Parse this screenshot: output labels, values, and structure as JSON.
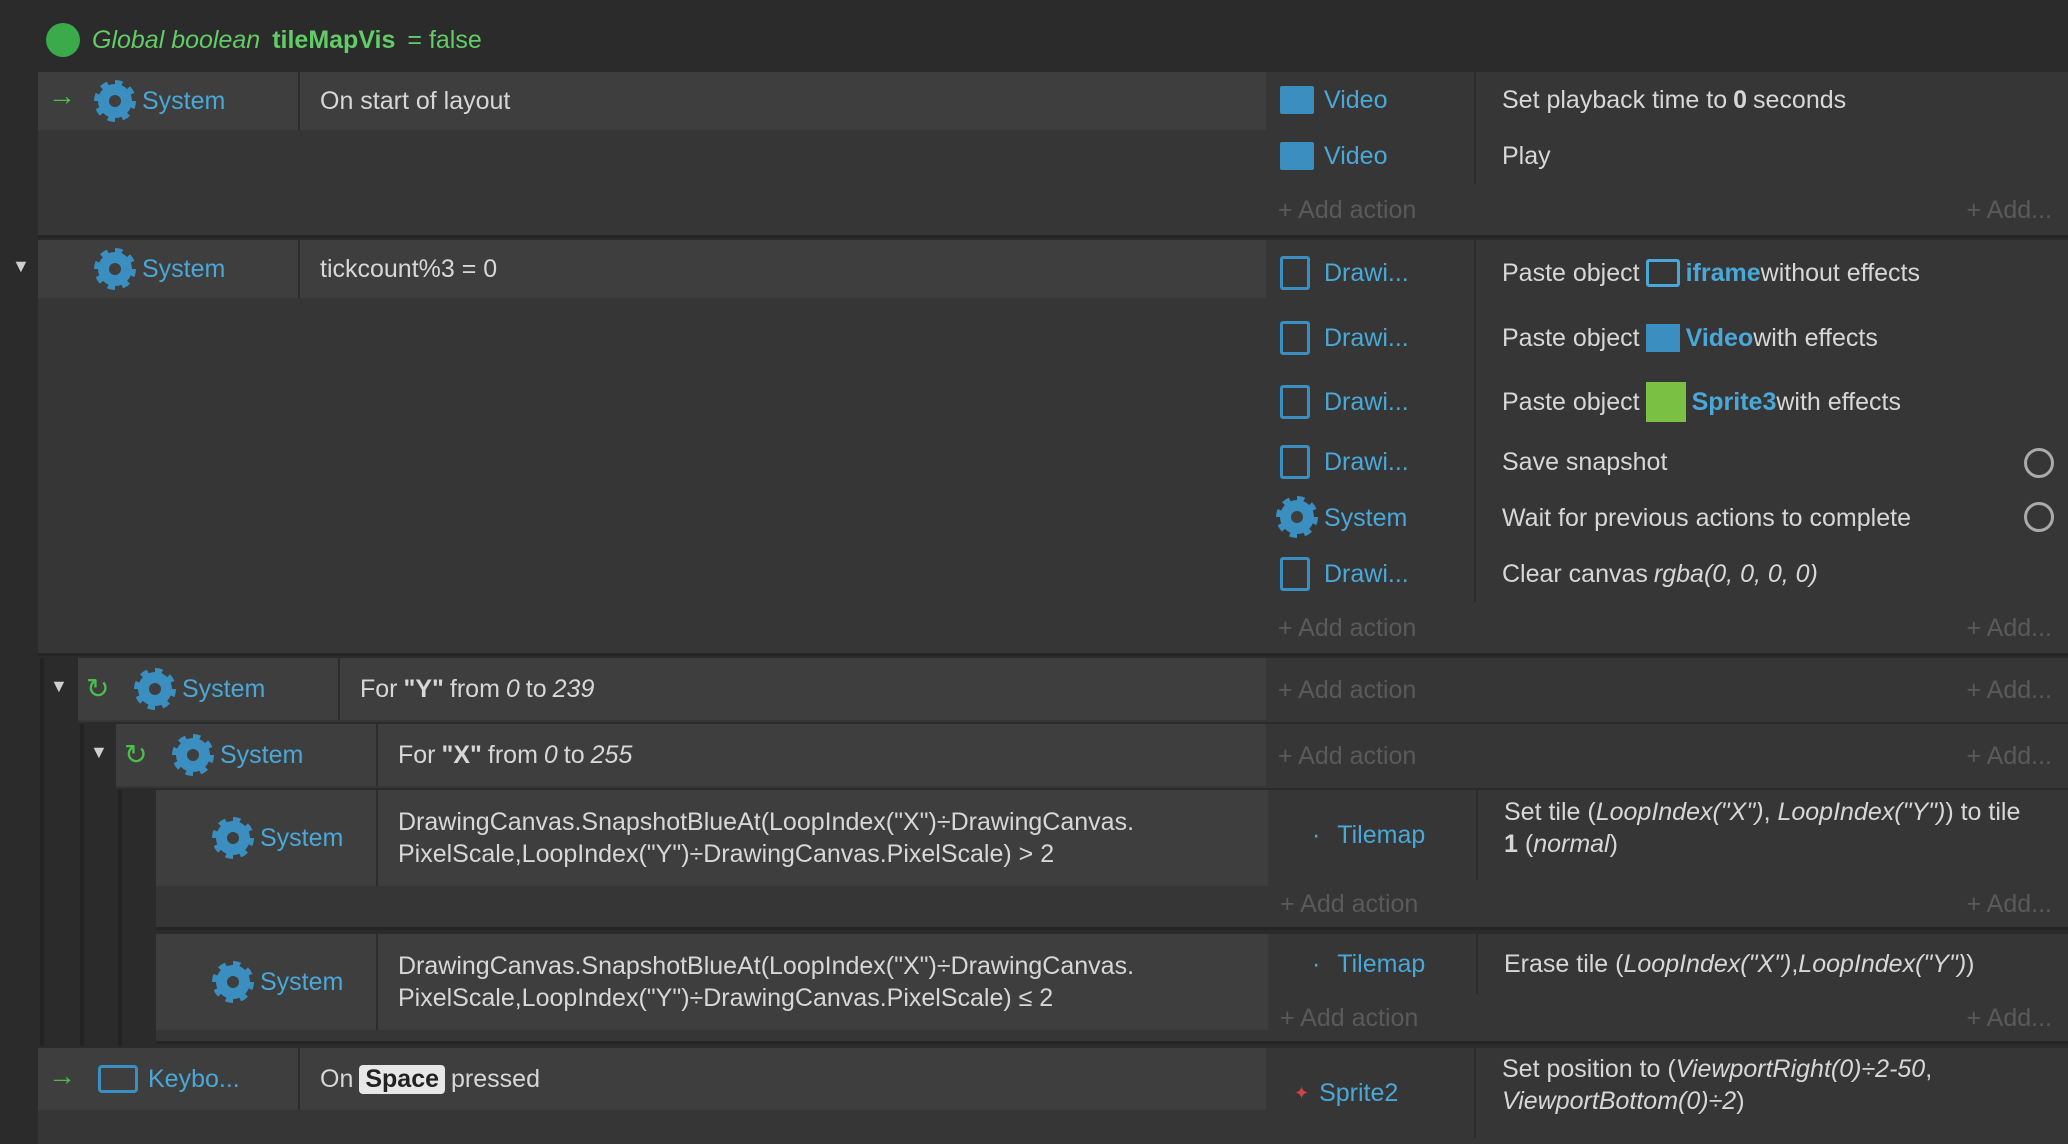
{
  "global": {
    "kw": "Global boolean",
    "name": "tileMapVis",
    "val": "= false"
  },
  "ev1": {
    "obj": "System",
    "cond": "On start of layout",
    "actions": [
      {
        "obj": "Video",
        "pre": "Set playback time to ",
        "bold": "0",
        "post": " seconds"
      },
      {
        "obj": "Video",
        "text": "Play"
      }
    ]
  },
  "ev2": {
    "obj": "System",
    "cond": "tickcount%3 = 0",
    "actions": [
      {
        "obj": "Drawi...",
        "pre": "Paste object ",
        "hl": "iframe",
        "post": " without effects"
      },
      {
        "obj": "Drawi...",
        "pre": "Paste object ",
        "hl": "Video",
        "post": " with effects"
      },
      {
        "obj": "Drawi...",
        "pre": "Paste object ",
        "hl": "Sprite3",
        "post": " with effects"
      },
      {
        "obj": "Drawi...",
        "text": "Save snapshot"
      },
      {
        "obj": "System",
        "text": "Wait for previous actions to complete"
      },
      {
        "obj": "Drawi...",
        "pre": "Clear canvas ",
        "it": "rgba(0, 0, 0, 0)"
      }
    ]
  },
  "ev3": {
    "obj": "System",
    "pre": "For ",
    "b": "\"Y\"",
    "mid": " from ",
    "a": "0",
    "to": " to ",
    "z": "239"
  },
  "ev4": {
    "obj": "System",
    "pre": "For ",
    "b": "\"X\"",
    "mid": " from ",
    "a": "0",
    "to": " to ",
    "z": "255"
  },
  "ev5": {
    "obj": "System",
    "l1": "DrawingCanvas.SnapshotBlueAt(LoopIndex(\"X\")÷DrawingCanvas.",
    "l2": "PixelScale,LoopIndex(\"Y\")÷DrawingCanvas.PixelScale) > 2",
    "aobj": "Tilemap",
    "a1": "Set tile (",
    "a2": "LoopIndex(\"X\")",
    "a3": ", ",
    "a4": "LoopIndex(\"Y\")",
    "a5": ") to tile",
    "a6": "1",
    "a7": " (",
    "a8": "normal",
    "a9": ")"
  },
  "ev6": {
    "obj": "System",
    "l1": "DrawingCanvas.SnapshotBlueAt(LoopIndex(\"X\")÷DrawingCanvas.",
    "l2": "PixelScale,LoopIndex(\"Y\")÷DrawingCanvas.PixelScale) ≤ 2",
    "aobj": "Tilemap",
    "a1": "Erase tile (",
    "a2": "LoopIndex(\"X\")",
    "a3": ", ",
    "a4": "LoopIndex(\"Y\")",
    "a5": ")"
  },
  "ev7": {
    "obj": "Keybo...",
    "pre": "On",
    "key": "Space",
    "post": "pressed",
    "aobj": "Sprite2",
    "a1": "Set position to (",
    "a2": "ViewportRight(0)÷2-50",
    "a3": ",",
    "a4": "ViewportBottom(0)÷2",
    "a5": ")"
  },
  "add_action": "+ Add action",
  "add_more": "+ Add..."
}
